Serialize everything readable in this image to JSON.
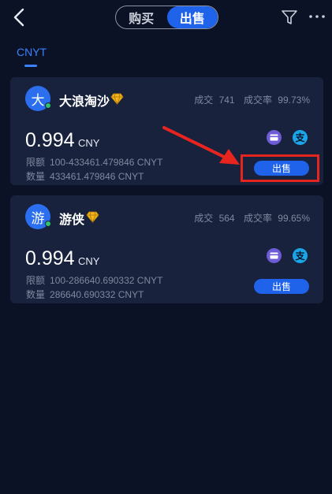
{
  "header": {
    "tabs": [
      {
        "label": "购买",
        "active": false
      },
      {
        "label": "出售",
        "active": true
      }
    ]
  },
  "coin_tab": {
    "label": "CNYT"
  },
  "colors": {
    "accent": "#1e63e9",
    "background": "#0b1226",
    "card": "#18223d",
    "annotation": "#e8241f"
  },
  "listings": [
    {
      "avatar_char": "大",
      "name": "大浪淘沙",
      "badge_icon": "diamond-icon",
      "trades_label": "成交",
      "trades": "741",
      "rate_label": "成交率",
      "rate": "99.73%",
      "price": "0.994",
      "currency": "CNY",
      "limit_label": "限额",
      "limit": "100-433461.479846 CNYT",
      "qty_label": "数量",
      "qty": "433461.479846 CNYT",
      "payment_icons": [
        "bank-card-icon",
        "alipay-icon"
      ],
      "alipay_glyph": "支",
      "action": "出售"
    },
    {
      "avatar_char": "游",
      "name": "游侠",
      "badge_icon": "diamond-icon",
      "trades_label": "成交",
      "trades": "564",
      "rate_label": "成交率",
      "rate": "99.65%",
      "price": "0.994",
      "currency": "CNY",
      "limit_label": "限额",
      "limit": "100-286640.690332 CNYT",
      "qty_label": "数量",
      "qty": "286640.690332 CNYT",
      "payment_icons": [
        "bank-card-icon",
        "alipay-icon"
      ],
      "alipay_glyph": "支",
      "action": "出售"
    }
  ]
}
